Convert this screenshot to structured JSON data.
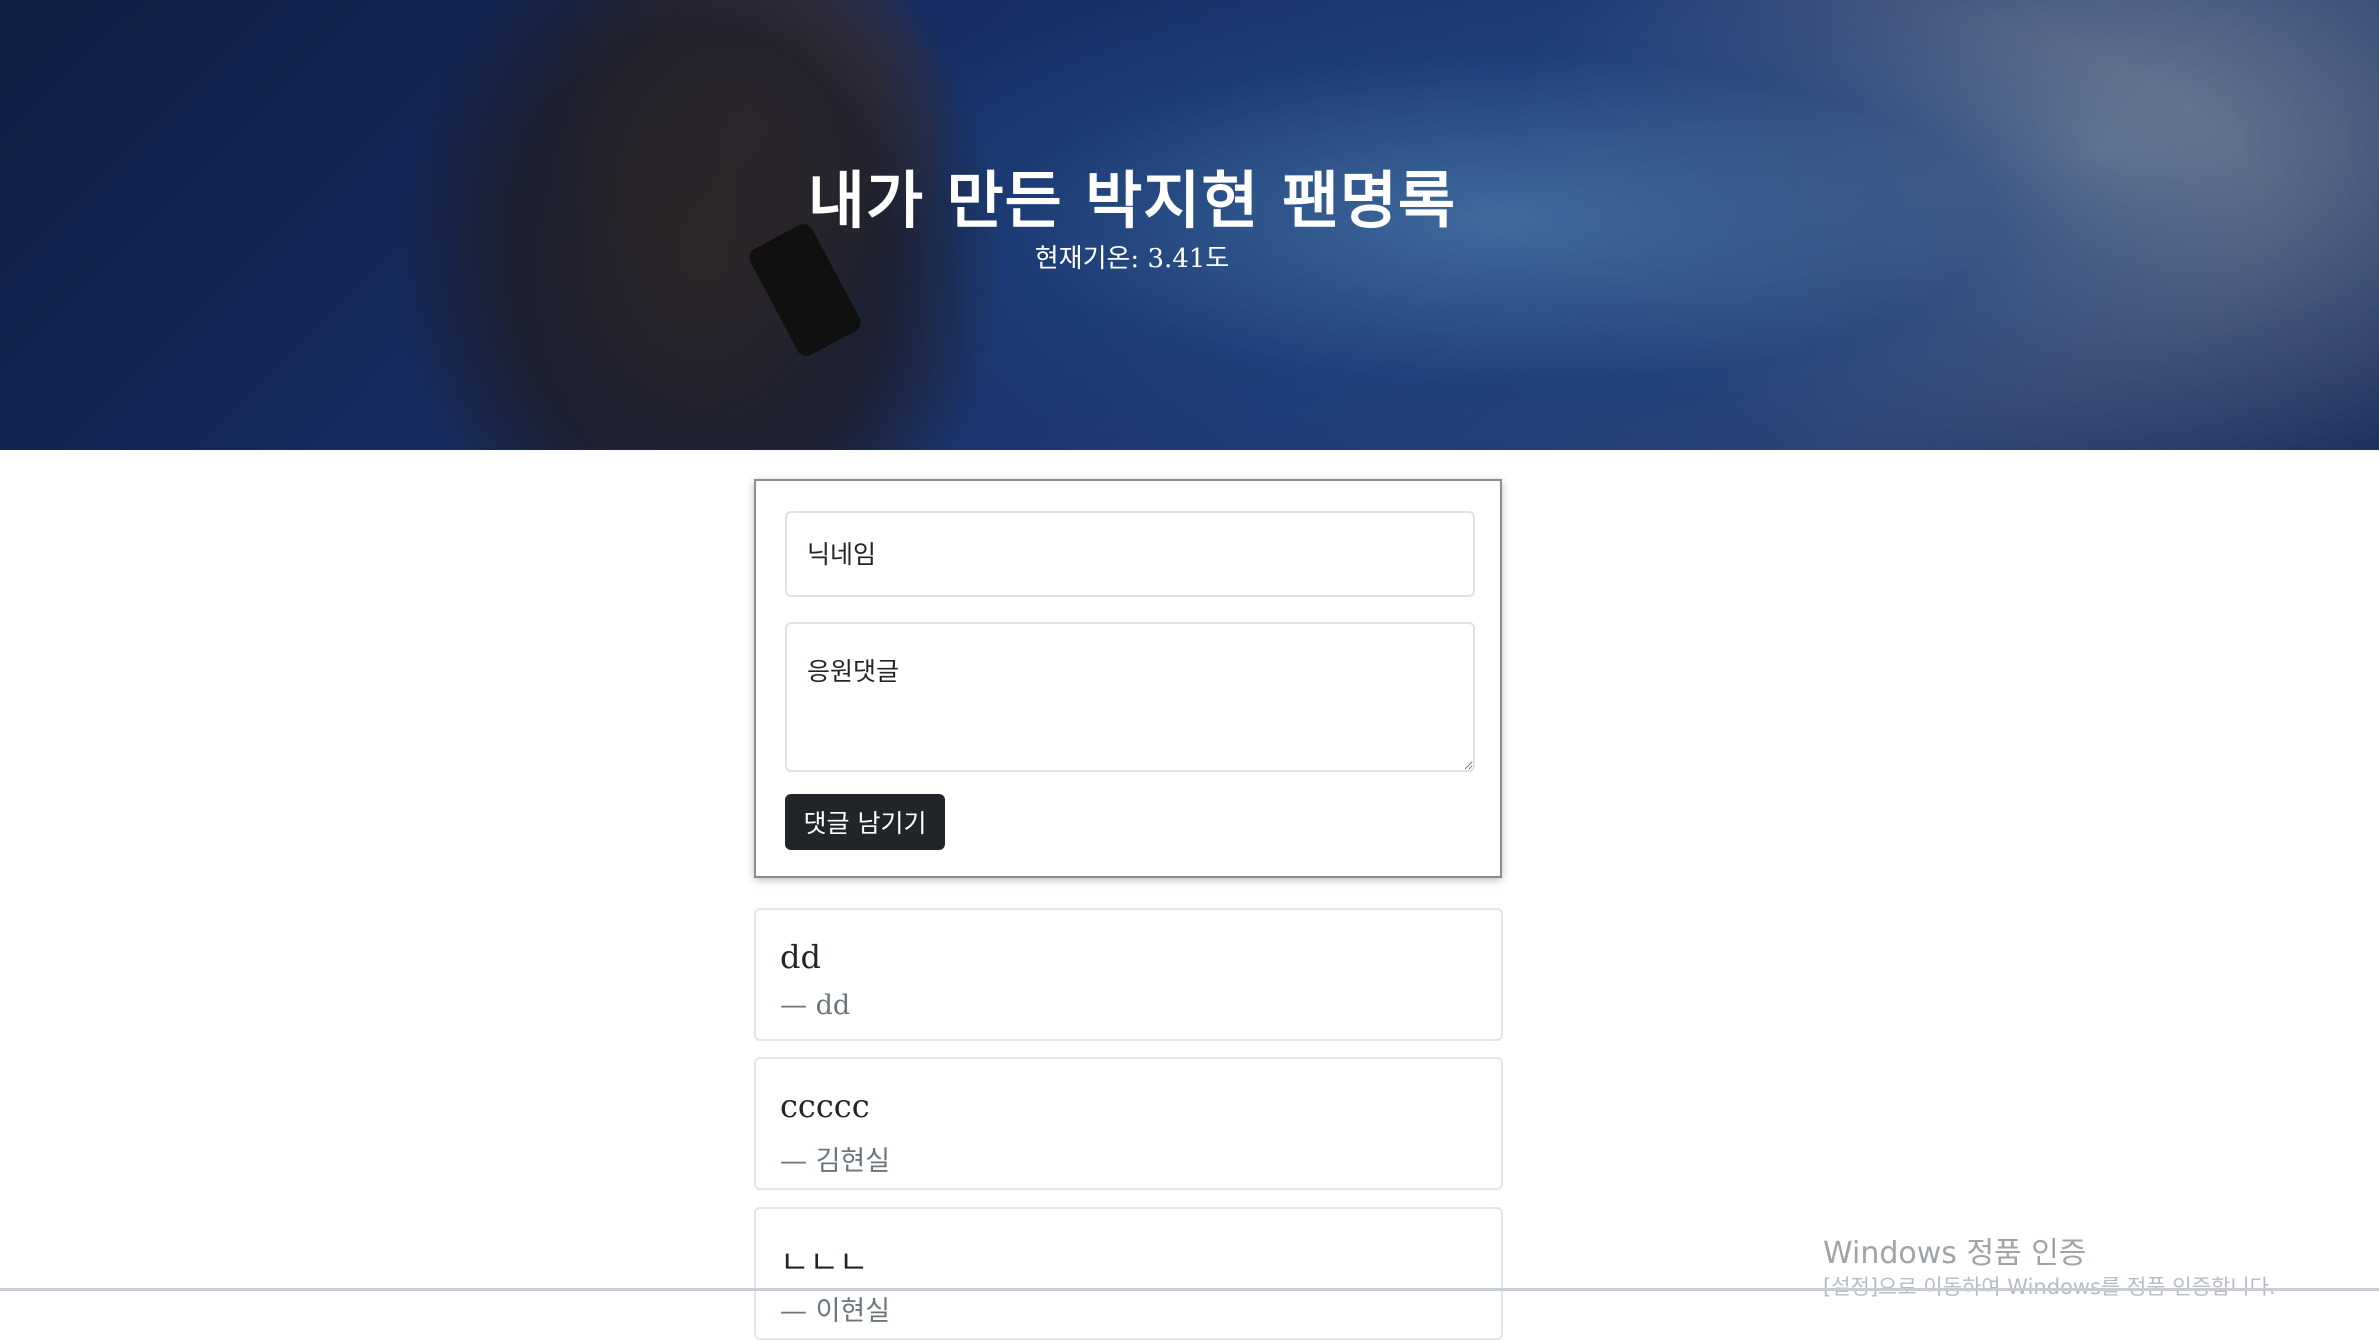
{
  "header": {
    "title": "내가 만든 박지현 팬명록",
    "temperature_text": "현재기온: 3.41도"
  },
  "form": {
    "nickname_placeholder": "닉네임",
    "comment_placeholder": "응원댓글",
    "submit_label": "댓글 남기기"
  },
  "comments": [
    {
      "text": "dd",
      "author": "— dd"
    },
    {
      "text": "ccccc",
      "author": "— 김현실"
    },
    {
      "text": "ㄴㄴㄴ",
      "author": "— 이현실"
    }
  ],
  "watermark": {
    "title": "Windows 정품 인증",
    "subtitle": "[설정]으로 이동하여 Windows를 정품 인증합니다."
  },
  "colors": {
    "button_bg": "#212529",
    "author_text": "#6c757d"
  }
}
